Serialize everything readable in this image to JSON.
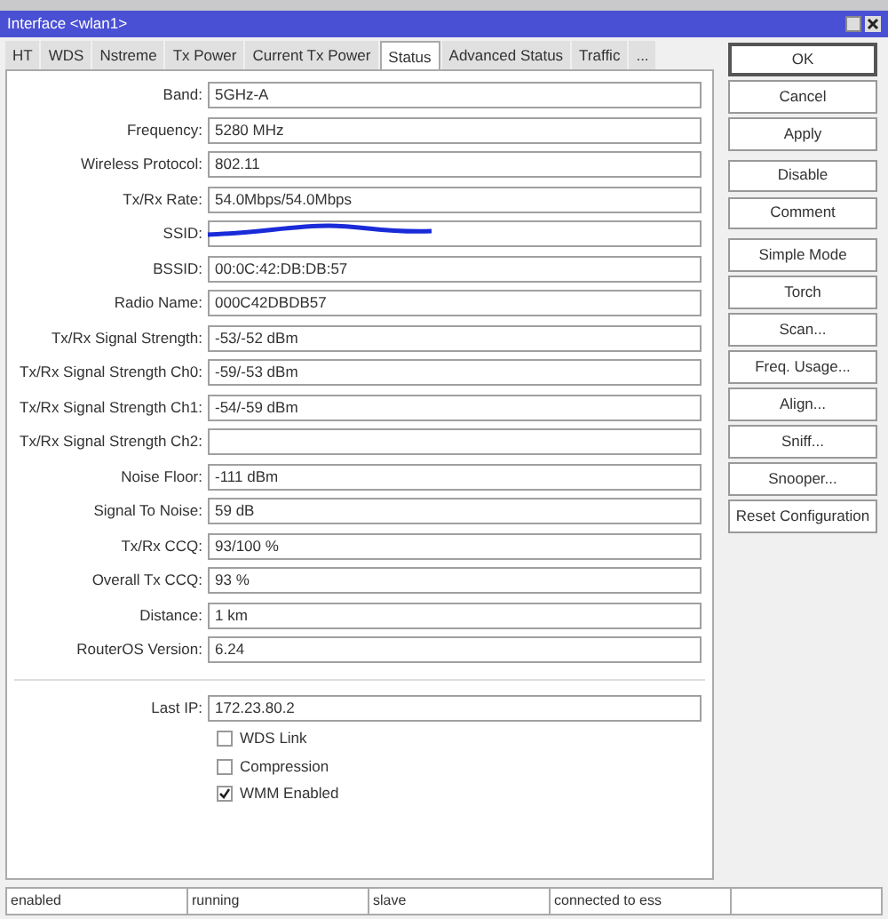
{
  "window": {
    "title": "Interface <wlan1>"
  },
  "tabs": [
    {
      "label": "HT",
      "selected": false
    },
    {
      "label": "WDS",
      "selected": false
    },
    {
      "label": "Nstreme",
      "selected": false
    },
    {
      "label": "Tx Power",
      "selected": false
    },
    {
      "label": "Current Tx Power",
      "selected": false
    },
    {
      "label": "Status",
      "selected": true
    },
    {
      "label": "Advanced Status",
      "selected": false
    },
    {
      "label": "Traffic",
      "selected": false
    },
    {
      "label": "...",
      "selected": false
    }
  ],
  "fields": [
    {
      "label": "Band:",
      "value": "5GHz-A",
      "scribbled": false
    },
    {
      "label": "Frequency:",
      "value": "5280 MHz",
      "scribbled": false
    },
    {
      "label": "Wireless Protocol:",
      "value": "802.11",
      "scribbled": false
    },
    {
      "label": "Tx/Rx Rate:",
      "value": "54.0Mbps/54.0Mbps",
      "scribbled": false
    },
    {
      "label": "SSID:",
      "scribbled": true
    },
    {
      "label": "BSSID:",
      "value": "00:0C:42:DB:DB:57",
      "scribbled": false
    },
    {
      "label": "Radio Name:",
      "value": "000C42DBDB57",
      "scribbled": false
    },
    {
      "label": "Tx/Rx Signal Strength:",
      "value": "-53/-52 dBm",
      "scribbled": false
    },
    {
      "label": "Tx/Rx Signal Strength Ch0:",
      "value": "-59/-53 dBm",
      "scribbled": false
    },
    {
      "label": "Tx/Rx Signal Strength Ch1:",
      "value": "-54/-59 dBm",
      "scribbled": false
    },
    {
      "label": "Tx/Rx Signal Strength Ch2:",
      "scribbled": false
    },
    {
      "label": "Noise Floor:",
      "value": "-111 dBm",
      "scribbled": false
    },
    {
      "label": "Signal To Noise:",
      "value": "59 dB",
      "scribbled": false
    },
    {
      "label": "Tx/Rx CCQ:",
      "value": "93/100 %",
      "scribbled": false
    },
    {
      "label": "Overall Tx CCQ:",
      "value": "93 %",
      "scribbled": false
    },
    {
      "label": "Distance:",
      "value": "1 km",
      "scribbled": false
    },
    {
      "label": "RouterOS Version:",
      "value": "6.24",
      "scribbled": false
    }
  ],
  "last_ip": {
    "label": "Last IP:",
    "value": "172.23.80.2"
  },
  "checkboxes": [
    {
      "label": "WDS Link",
      "checked": false
    },
    {
      "label": "Compression",
      "checked": false
    },
    {
      "label": "WMM Enabled",
      "checked": true
    }
  ],
  "button_groups": [
    [
      {
        "label": "OK",
        "default": true
      },
      {
        "label": "Cancel",
        "default": false
      },
      {
        "label": "Apply",
        "default": false
      }
    ],
    [
      {
        "label": "Disable",
        "default": false
      },
      {
        "label": "Comment",
        "default": false
      }
    ],
    [
      {
        "label": "Simple Mode",
        "default": false
      },
      {
        "label": "Torch",
        "default": false
      },
      {
        "label": "Scan...",
        "default": false
      },
      {
        "label": "Freq. Usage...",
        "default": false
      },
      {
        "label": "Align...",
        "default": false
      },
      {
        "label": "Sniff...",
        "default": false
      },
      {
        "label": "Snooper...",
        "default": false
      },
      {
        "label": "Reset Configuration",
        "default": false
      }
    ]
  ],
  "status_bar": [
    "enabled",
    "running",
    "slave",
    "connected to ess"
  ]
}
